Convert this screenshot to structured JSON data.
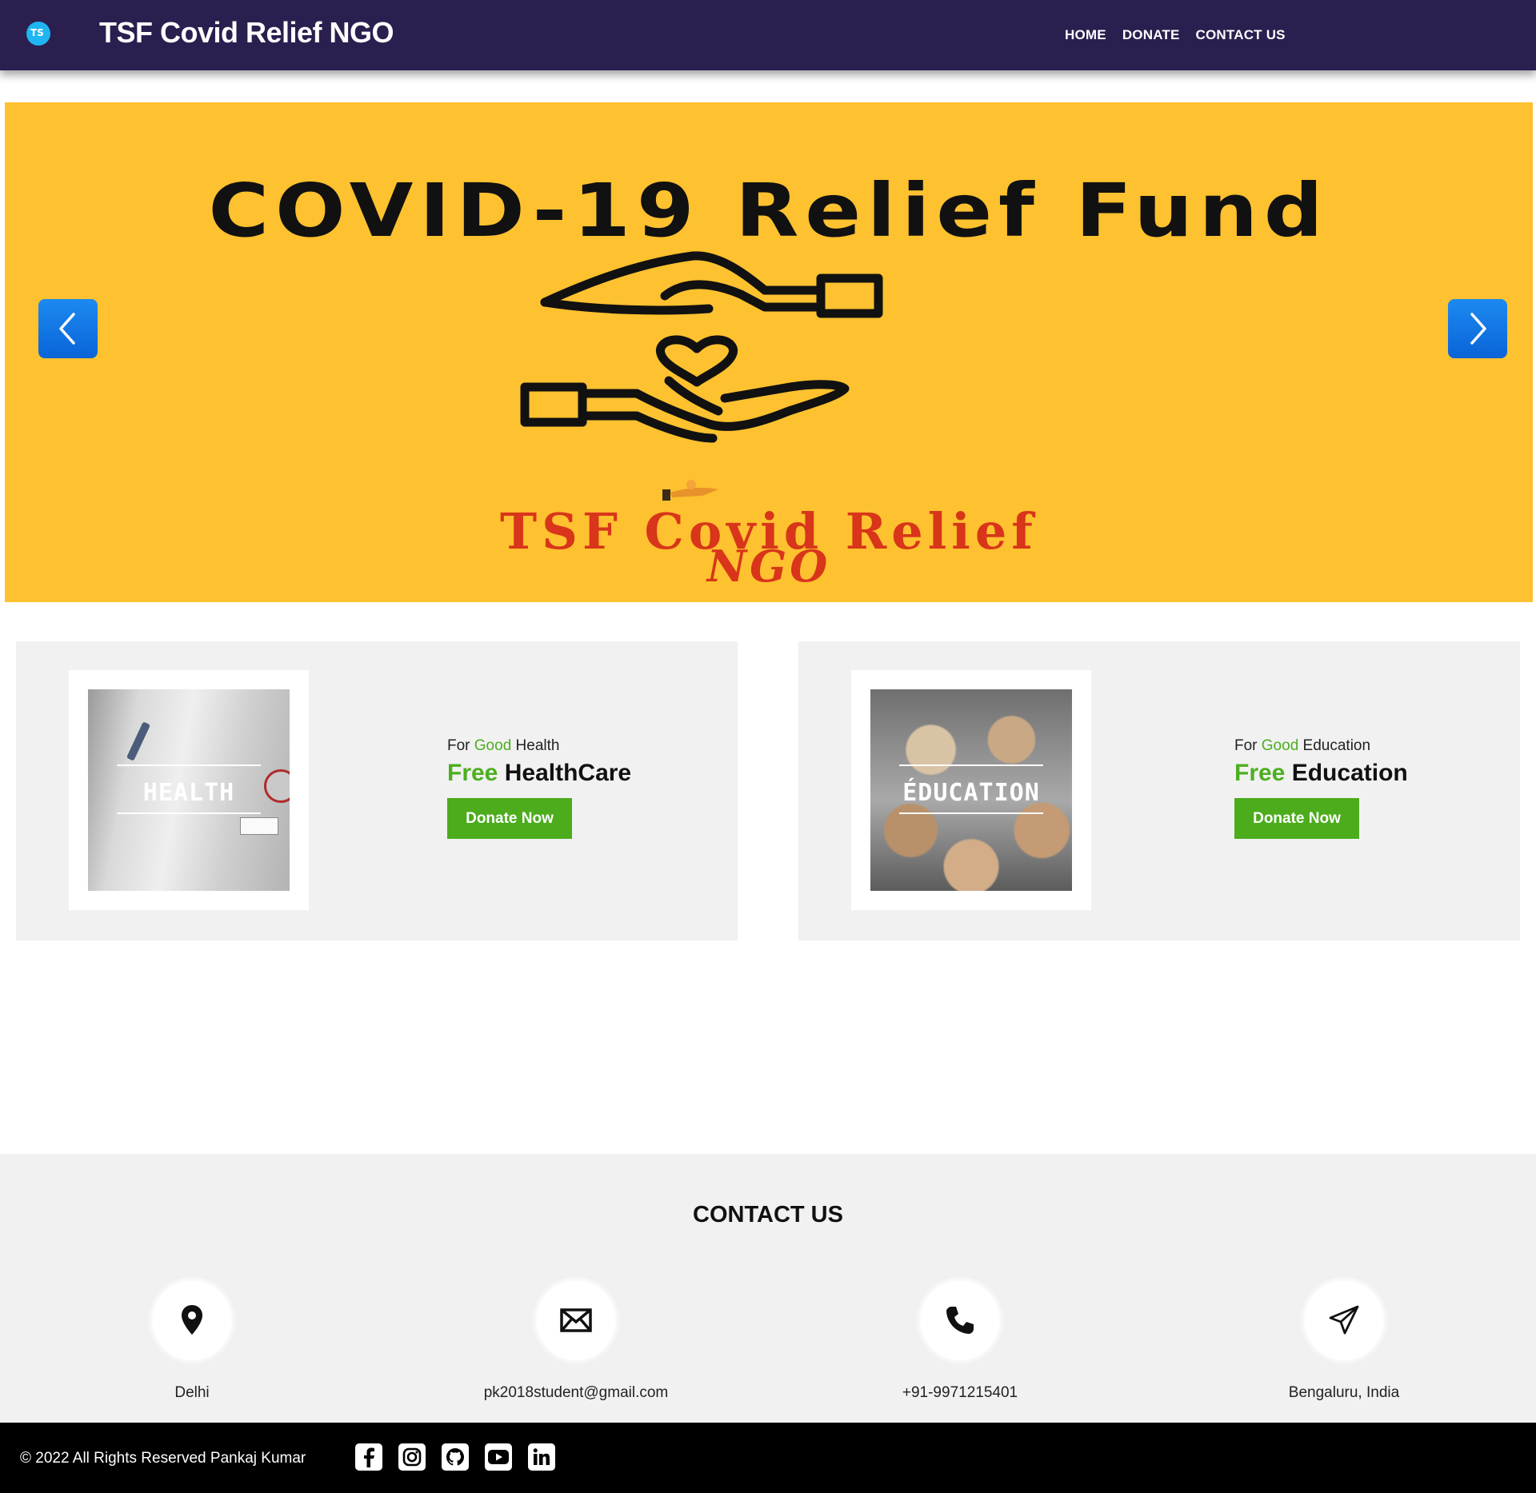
{
  "navbar": {
    "title": "TSF Covid Relief NGO",
    "links": [
      "HOME",
      "DONATE",
      "CONTACT US"
    ]
  },
  "banner": {
    "heading": "COVID-19 Relief Fund",
    "subtitle": "TSF Covid Relief",
    "script": "NGO",
    "background": "#fec12f"
  },
  "cards": [
    {
      "image_label": "HEALTH",
      "tag_prefix": "For",
      "tag_highlight": "Good",
      "tag_suffix": "Health",
      "headline_highlight": "Free",
      "headline_rest": "HealthCare",
      "button": "Donate Now"
    },
    {
      "image_label": "ÉDUCATION",
      "tag_prefix": "For",
      "tag_highlight": "Good",
      "tag_suffix": "Education",
      "headline_highlight": "Free",
      "headline_rest": "Education",
      "button": "Donate Now"
    }
  ],
  "contact": {
    "title": "CONTACT US",
    "items": [
      {
        "icon": "location-pin-icon",
        "label": "Delhi"
      },
      {
        "icon": "envelope-icon",
        "label": "pk2018student@gmail.com"
      },
      {
        "icon": "phone-icon",
        "label": "+91-9971215401"
      },
      {
        "icon": "paper-plane-icon",
        "label": "Bengaluru, India"
      }
    ]
  },
  "footer": {
    "copyright": "© 2022 All Rights Reserved Pankaj Kumar",
    "social": [
      "facebook-icon",
      "instagram-icon",
      "github-icon",
      "youtube-icon",
      "linkedin-icon"
    ]
  },
  "colors": {
    "navbar": "#2b1f4f",
    "accent_green": "#4cac1c",
    "carousel_button": "#0a64d8",
    "footer": "#000000"
  }
}
